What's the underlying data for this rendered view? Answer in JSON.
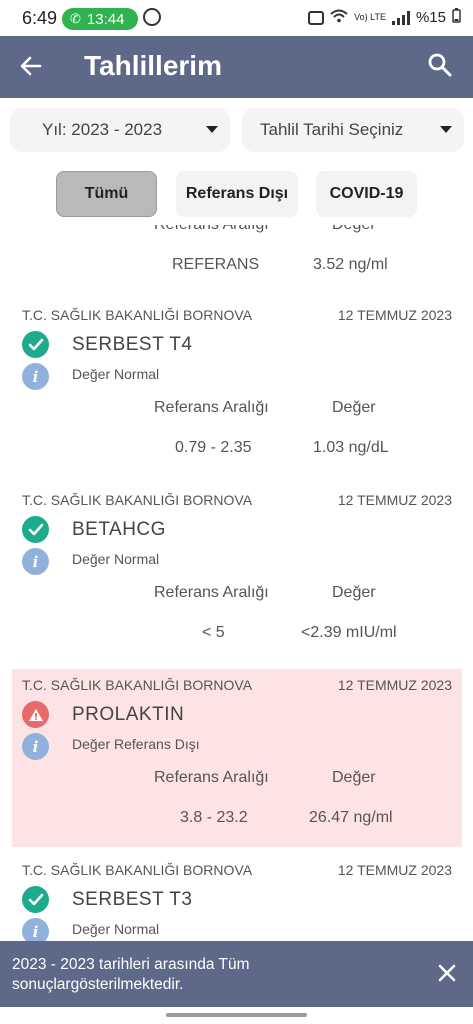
{
  "status_bar": {
    "time": "6:49",
    "call_time": "13:44",
    "battery": "%15",
    "network": "Vo) LTE"
  },
  "app_bar": {
    "title": "Tahlillerim",
    "back_icon": "arrow-left-icon",
    "search_icon": "search-icon",
    "color": "#5e6888"
  },
  "filters": {
    "year": "Yıl: 2023 - 2023",
    "date": "Tahlil Tarihi Seçiniz"
  },
  "tabs": [
    {
      "label": "Tümü",
      "active": true
    },
    {
      "label": "Referans Dışı",
      "active": false
    },
    {
      "label": "COVID-19",
      "active": false
    }
  ],
  "results_header": {
    "ref_label": "Referans Aralığı",
    "value_label": "Değer"
  },
  "partial_result": {
    "ref_label": "Referans Aralığı",
    "value_label": "Değer",
    "reference": "REFERANS",
    "value": "3.52 ng/ml"
  },
  "results": [
    {
      "hospital": "T.C. SAĞLIK BAKANLIĞI BORNOVA",
      "date": "12 TEMMUZ 2023",
      "test": "SERBEST T4",
      "note": "Değer Normal",
      "reference": "0.79 - 2.35",
      "value": "1.03 ng/dL",
      "status": "normal"
    },
    {
      "hospital": "T.C. SAĞLIK BAKANLIĞI BORNOVA",
      "date": "12 TEMMUZ 2023",
      "test": "BETAHCG",
      "note": "Değer Normal",
      "reference": "< 5",
      "value": "<2.39 mIU/ml",
      "status": "normal"
    },
    {
      "hospital": "T.C. SAĞLIK BAKANLIĞI BORNOVA",
      "date": "12 TEMMUZ 2023",
      "test": "PROLAKTIN",
      "note": "Değer Referans Dışı",
      "reference": "3.8 - 23.2",
      "value": "26.47 ng/ml",
      "status": "out_of_range"
    },
    {
      "hospital": "T.C. SAĞLIK BAKANLIĞI BORNOVA",
      "date": "12 TEMMUZ 2023",
      "test": "SERBEST T3",
      "note": "Değer Normal",
      "status": "normal"
    }
  ],
  "snackbar": {
    "message": "2023 - 2023 tarihleri arasında Tüm sonuçlargösterilmektedir.",
    "close_icon": "close-icon"
  },
  "colors": {
    "normal_icon": "#1eaa8c",
    "warning_icon": "#e86a6a",
    "alert_background": "#fde3e3",
    "info_icon": "#8fb1db"
  }
}
